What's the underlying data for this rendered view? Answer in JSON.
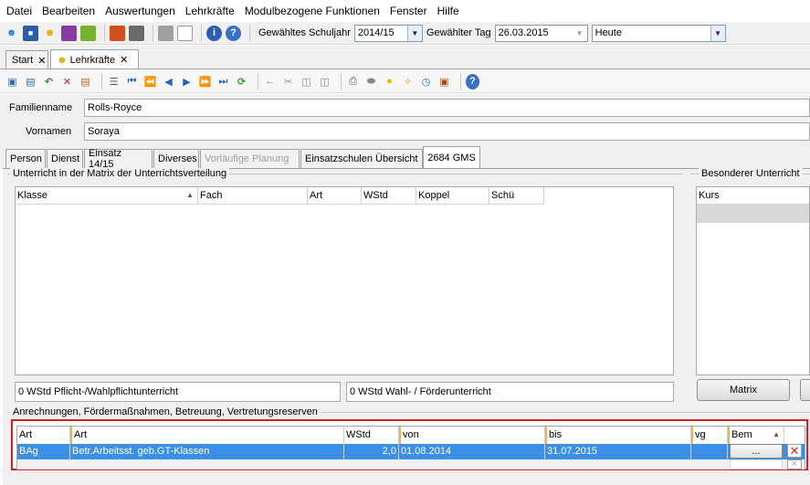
{
  "menu": [
    "Datei",
    "Bearbeiten",
    "Auswertungen",
    "Lehrkräfte",
    "Modulbezogene Funktionen",
    "Fenster",
    "Hilfe"
  ],
  "toolbar": {
    "schuljahr_label": "Gewähltes Schuljahr",
    "schuljahr_value": "2014/15",
    "tag_label": "Gewählter Tag",
    "tag_value": "26.03.2015",
    "heute_value": "Heute"
  },
  "doc_tabs": [
    {
      "label": "Start"
    },
    {
      "label": "Lehrkräfte"
    }
  ],
  "form": {
    "familienname_label": "Familienname",
    "familienname_value": "Rolls-Royce",
    "vornamen_label": "Vornamen",
    "vornamen_value": "Soraya"
  },
  "sub_tabs": [
    "Person",
    "Dienst",
    "Einsatz 14/15",
    "Diverses",
    "Vorläufige Planung",
    "Einsatzschulen Übersicht",
    "2684 GMS"
  ],
  "unterricht": {
    "title": "Unterricht in der Matrix der Unterrichtsverteilung",
    "columns": [
      "Klasse",
      "Fach",
      "Art",
      "WStd",
      "Koppel",
      "Schü"
    ],
    "summary_pflicht": "0 WStd Pflicht-/Wahlpflichtunterricht",
    "summary_wahl": "0 WStd Wahl- / Förderunterricht"
  },
  "besonderer": {
    "title": "Besonderer Unterricht",
    "columns": [
      "Kurs"
    ],
    "matrix_button": "Matrix"
  },
  "anrechnungen": {
    "title": "Anrechnungen, Fördermaßnahmen, Betreuung, Vertretungsreserven",
    "columns": [
      "Art",
      "Art",
      "WStd",
      "von",
      "bis",
      "vg",
      "Bem"
    ],
    "rows": [
      {
        "art_code": "BAg",
        "art_text": "Betr.Arbeitsst. geb.GT-Klassen",
        "wstd": "2,0",
        "von": "01.08.2014",
        "bis": "31.07.2015",
        "vg": "",
        "bem_button": "..."
      }
    ]
  },
  "colors": {
    "selection": "#3b8fe4",
    "highlight_border": "#d42020",
    "panel_bg": "#f0f0f0"
  }
}
